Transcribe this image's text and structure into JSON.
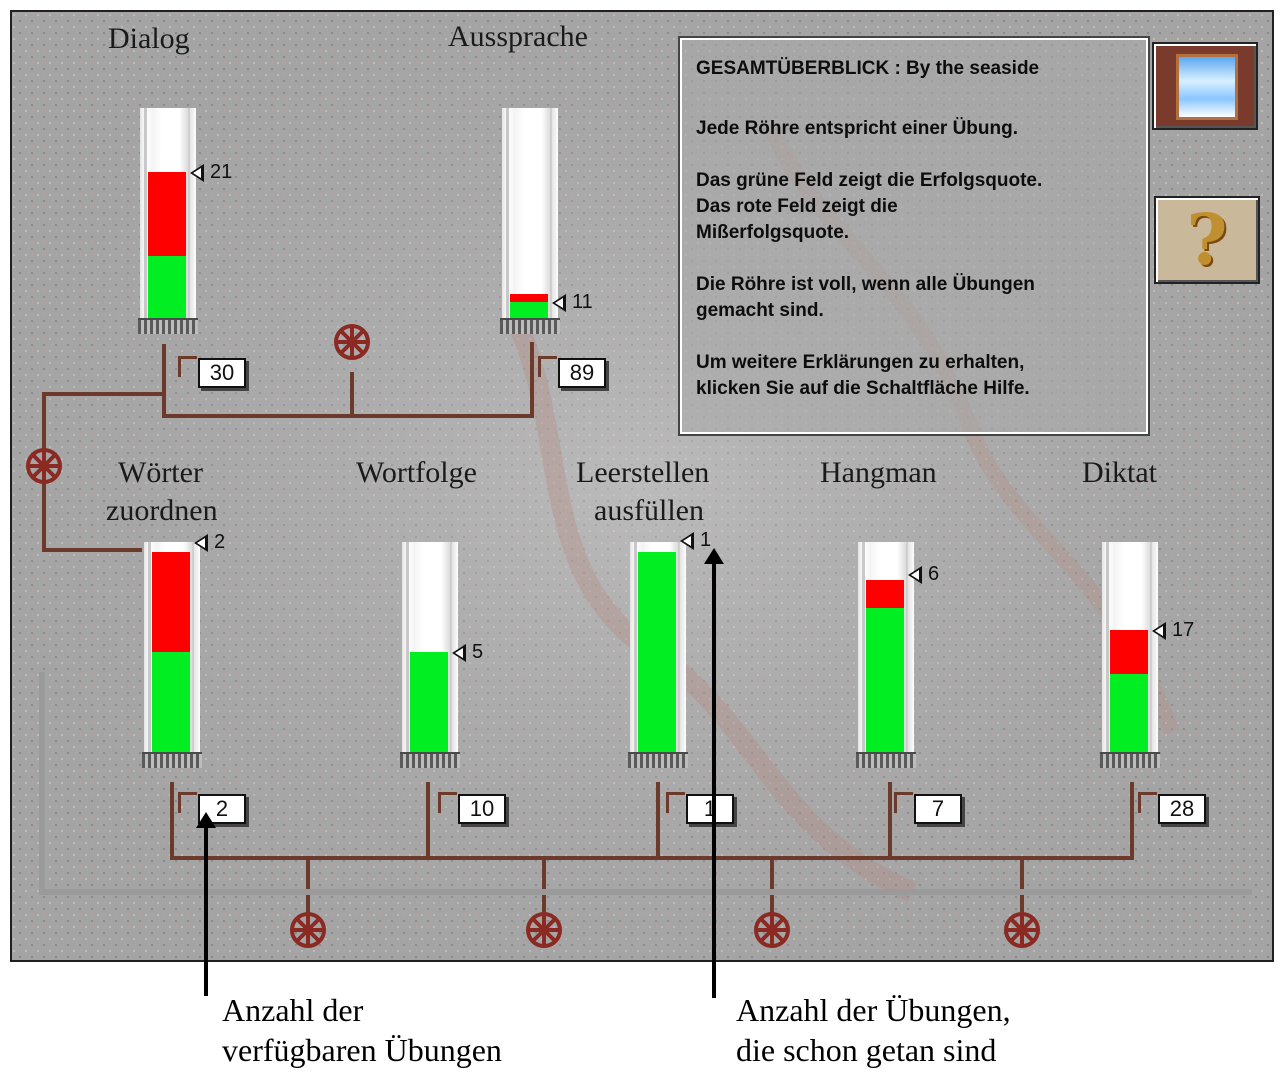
{
  "info_panel": {
    "title": "GESAMTÜBERBLICK : By the seaside",
    "line1": "Jede Röhre entspricht einer Übung.",
    "line2": "Das grüne Feld zeigt die Erfolgsquote.",
    "line3": "Das rote Feld zeigt die",
    "line4": "Mißerfolgsquote.",
    "line5": "Die Röhre ist voll, wenn alle Übungen",
    "line6": "gemacht sind.",
    "line7": "Um weitere Erklärungen zu erhalten,",
    "line8": "klicken Sie auf die Schaltfläche Hilfe."
  },
  "buttons": {
    "window_icon": "window-sky-icon",
    "help_icon": "question-mark-icon",
    "help_glyph": "?"
  },
  "tubes": [
    {
      "id": "dialog",
      "label_line1": "Dialog",
      "label_line2": "",
      "done": "21",
      "available": "30",
      "green_frac": 0.31,
      "red_frac": 0.42
    },
    {
      "id": "aussprache",
      "label_line1": "Aussprache",
      "label_line2": "",
      "done": "11",
      "available": "89",
      "green_frac": 0.08,
      "red_frac": 0.04
    },
    {
      "id": "woerter",
      "label_line1": "Wörter",
      "label_line2": "zuordnen",
      "done": "2",
      "available": "2",
      "green_frac": 0.5,
      "red_frac": 0.5
    },
    {
      "id": "wortfolge",
      "label_line1": "Wortfolge",
      "label_line2": "",
      "done": "5",
      "available": "10",
      "green_frac": 0.5,
      "red_frac": 0.0
    },
    {
      "id": "leerstellen",
      "label_line1": "Leerstellen",
      "label_line2": "ausfüllen",
      "done": "1",
      "available": "1",
      "green_frac": 1.0,
      "red_frac": 0.0
    },
    {
      "id": "hangman",
      "label_line1": "Hangman",
      "label_line2": "",
      "done": "6",
      "available": "7",
      "green_frac": 0.72,
      "red_frac": 0.14
    },
    {
      "id": "diktat",
      "label_line1": "Diktat",
      "label_line2": "",
      "done": "17",
      "available": "28",
      "green_frac": 0.39,
      "red_frac": 0.22
    }
  ],
  "annotations": {
    "left_line1": "Anzahl der",
    "left_line2": "verfügbaren Übungen",
    "right_line1": "Anzahl der Übungen,",
    "right_line2": "die schon getan sind"
  },
  "colors": {
    "success": "#00ee22",
    "failure": "#ff0000",
    "pipe": "#6b3a2a",
    "background": "#a6a6a6"
  }
}
